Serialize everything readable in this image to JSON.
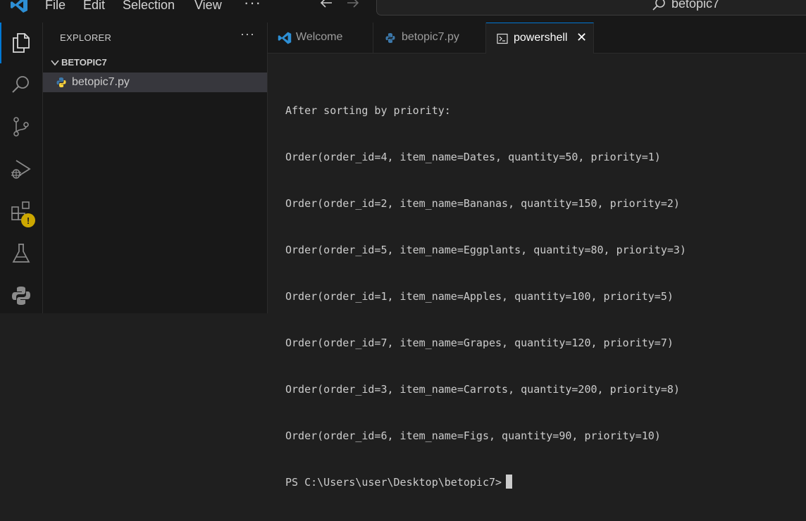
{
  "menubar": {
    "items": [
      "File",
      "Edit",
      "Selection",
      "View"
    ],
    "more": "···"
  },
  "command_center": {
    "text": "betopic7"
  },
  "activity_bar": {
    "icons": [
      "explorer-icon",
      "search-icon",
      "source-control-icon",
      "run-debug-icon",
      "extensions-icon",
      "testing-icon",
      "python-icon"
    ],
    "warning_badge": "!"
  },
  "sidebar": {
    "title": "EXPLORER",
    "more": "···",
    "folder": "BETOPIC7",
    "files": [
      "betopic7.py"
    ]
  },
  "tabs": [
    {
      "label": "Welcome",
      "icon": "vscode-icon",
      "active": false
    },
    {
      "label": "betopic7.py",
      "icon": "python-file-icon",
      "active": false
    },
    {
      "label": "powershell",
      "icon": "terminal-icon",
      "active": true,
      "close": "✕"
    }
  ],
  "terminal": {
    "lines": [
      "After sorting by priority:",
      "Order(order_id=4, item_name=Dates, quantity=50, priority=1)",
      "Order(order_id=2, item_name=Bananas, quantity=150, priority=2)",
      "Order(order_id=5, item_name=Eggplants, quantity=80, priority=3)",
      "Order(order_id=1, item_name=Apples, quantity=100, priority=5)",
      "Order(order_id=7, item_name=Grapes, quantity=120, priority=7)",
      "Order(order_id=3, item_name=Carrots, quantity=200, priority=8)",
      "Order(order_id=6, item_name=Figs, quantity=90, priority=10)"
    ],
    "prompt": "PS C:\\Users\\user\\Desktop\\betopic7>"
  },
  "colors": {
    "accent": "#0078d4",
    "python_blue": "#3c78aa",
    "python_yellow": "#ffd43b",
    "warning": "#cca700",
    "vscode_blue": "#2d8fd5"
  }
}
